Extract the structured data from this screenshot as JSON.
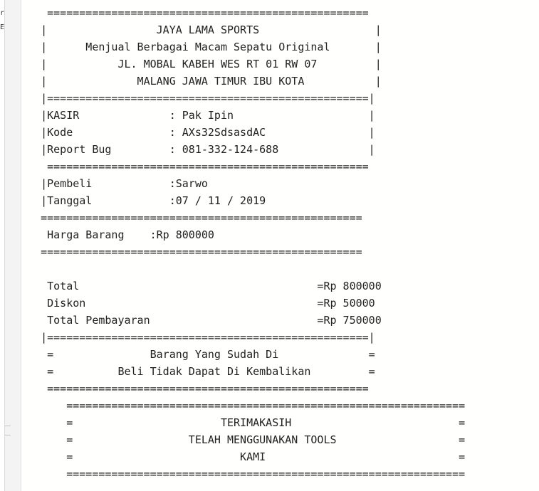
{
  "left_fragments": [
    "r",
    "E"
  ],
  "receipt": {
    "lines": [
      "    ==================================================",
      "   |                 JAYA LAMA SPORTS                  |",
      "   |      Menjual Berbagai Macam Sepatu Original       |",
      "   |           JL. MOBAL KABEH WES RT 01 RW 07         |",
      "   |              MALANG JAWA TIMUR IBU KOTA           |",
      "   |==================================================|",
      "   |KASIR              : Pak Ipin                     |",
      "   |Kode               : AXs32SdsasdAC                |",
      "   |Report Bug         : 081-332-124-688              |",
      "    ==================================================",
      "   |Pembeli            :Sarwo",
      "   |Tanggal            :07 / 11 / 2019",
      "   ==================================================",
      "    Harga Barang    :Rp 800000",
      "   ==================================================",
      "",
      "    Total                                     =Rp 800000",
      "    Diskon                                    =Rp 50000",
      "    Total Pembayaran                          =Rp 750000",
      "   |==================================================|",
      "    =               Barang Yang Sudah Di              =",
      "    =          Beli Tidak Dapat Di Kembalikan         =",
      "    ==================================================",
      "       ==============================================================",
      "       =                       TERIMAKASIH                          =",
      "       =                  TELAH MENGGUNAKAN TOOLS                   =",
      "       =                          KAMI                              =",
      "       =============================================================="
    ]
  }
}
